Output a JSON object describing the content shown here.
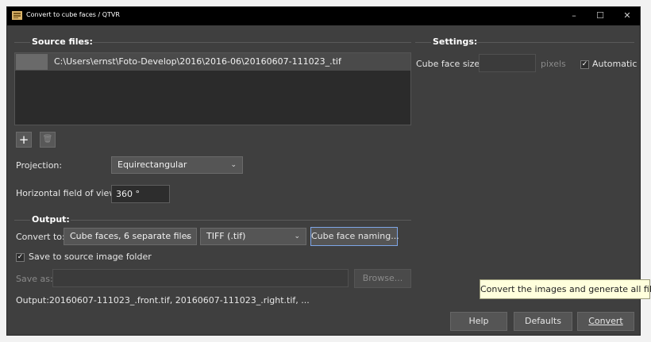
{
  "window": {
    "title": "Convert to cube faces / QTVR",
    "minimize": "–",
    "maximize": "☐",
    "close": "✕"
  },
  "source": {
    "title": "Source files:",
    "files": [
      {
        "path": "C:\\Users\\ernst\\Foto-Develop\\2016\\2016-06\\20160607-111023_.tif"
      }
    ],
    "add_icon": "+",
    "delete_icon": "🗑"
  },
  "projection": {
    "label": "Projection:",
    "value": "Equirectangular"
  },
  "hfov": {
    "label": "Horizontal field of view:",
    "value": "360 °"
  },
  "output": {
    "title": "Output:",
    "convert_label": "Convert to:",
    "convert_value": "Cube faces, 6 separate files",
    "format_value": "TIFF (.tif)",
    "naming_button": "Cube face naming...",
    "save_to_source_label": "Save to source image folder",
    "save_to_source_checked": "✓",
    "save_as_label": "Save as:",
    "save_as_value": "",
    "browse_button": "Browse...",
    "output_text": "Output:20160607-111023_.front.tif, 20160607-111023_.right.tif, ..."
  },
  "settings": {
    "title": "Settings:",
    "cube_face_size_label": "Cube face size:",
    "cube_face_size_value": "",
    "pixels_label": "pixels",
    "automatic_label": "Automatic",
    "automatic_checked": "✓"
  },
  "footer": {
    "help": "Help",
    "defaults": "Defaults",
    "convert": "Convert"
  },
  "tooltip": {
    "text": "Convert the images and generate all files."
  },
  "colors": {
    "background": "#3f3f3f",
    "titlebar": "#000000",
    "focus_border": "#7ea6e8",
    "tooltip_bg": "#ffffdc"
  }
}
